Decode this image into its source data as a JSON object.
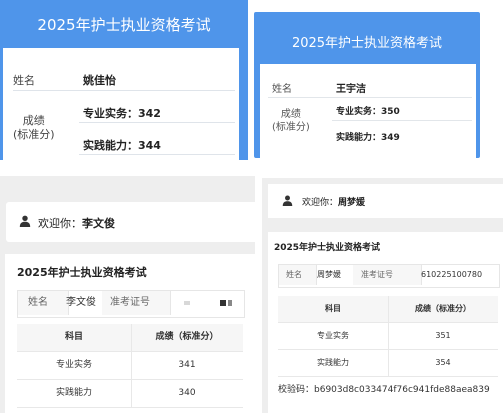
{
  "panel1": {
    "title": "2025年护士执业资格考试",
    "name_label": "姓名",
    "name_value": "姚佳怡",
    "score_label_line1": "成绩",
    "score_label_line2": "(标准分)",
    "score1": "专业实务：342",
    "score2": "实践能力：344"
  },
  "panel2": {
    "title": "2025年护士执业资格考试",
    "name_label": "姓名",
    "name_value": "王宇洁",
    "score_label_line1": "成绩",
    "score_label_line2": "(标准分)",
    "score1": "专业实务：350",
    "score2": "实践能力：349"
  },
  "panel3": {
    "welcome_prefix": "欢迎你：",
    "welcome_name": "李文俊",
    "title": "2025年护士执业资格考试",
    "info": {
      "name_label": "姓名",
      "name_value": "李文俊",
      "ticket_label": "准考证号"
    },
    "table": {
      "headers": [
        "科目",
        "成绩（标准分）"
      ],
      "rows": [
        [
          "专业实务",
          "341"
        ],
        [
          "实践能力",
          "340"
        ]
      ]
    }
  },
  "panel4": {
    "welcome_prefix": "欢迎你：",
    "welcome_name": "周梦媛",
    "title": "2025年护士执业资格考试",
    "info": {
      "name_label": "姓名",
      "name_value": "周梦媛",
      "ticket_label": "准考证号",
      "ticket_value": "610225100780"
    },
    "table": {
      "headers": [
        "科目",
        "成绩（标准分）"
      ],
      "rows": [
        [
          "专业实务",
          "351"
        ],
        [
          "实践能力",
          "354"
        ]
      ]
    },
    "check_code": "校验码：b6903d8c033474f76c941fde88aea839"
  },
  "colors": {
    "header_blue": "#4f95ea",
    "panel_gray": "#eeeeee"
  },
  "icons": [
    "user-icon"
  ]
}
